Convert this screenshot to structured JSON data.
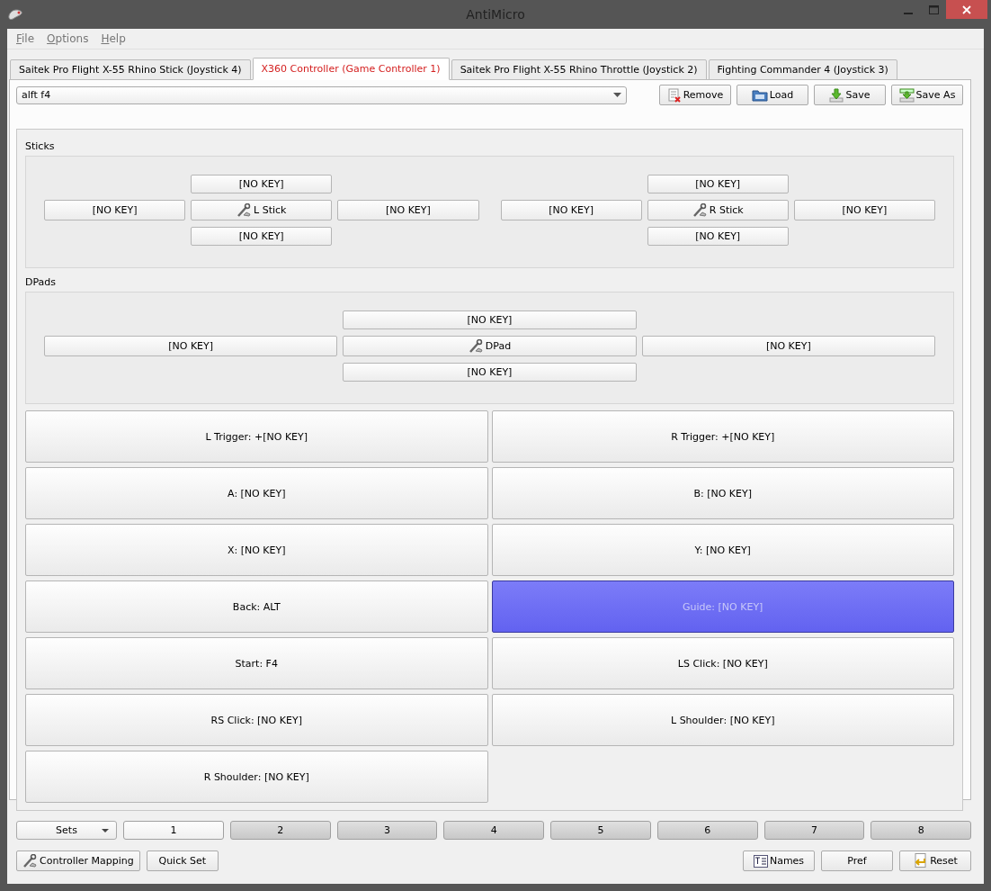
{
  "window": {
    "title": "AntiMicro"
  },
  "menu": [
    "File",
    "Options",
    "Help"
  ],
  "tabs": [
    {
      "label": "Saitek Pro Flight X-55 Rhino Stick (Joystick 4)",
      "selected": false
    },
    {
      "label": "X360 Controller (Game Controller 1)",
      "selected": true
    },
    {
      "label": "Saitek Pro Flight X-55 Rhino Throttle (Joystick 2)",
      "selected": false
    },
    {
      "label": "Fighting Commander 4 (Joystick 3)",
      "selected": false
    }
  ],
  "profile": {
    "value": "alft f4"
  },
  "profile_buttons": [
    {
      "kind": "remove",
      "label": "Remove"
    },
    {
      "kind": "load",
      "label": "Load"
    },
    {
      "kind": "save",
      "label": "Save"
    },
    {
      "kind": "saveas",
      "label": "Save As"
    }
  ],
  "sticks": {
    "title": "Sticks",
    "items": [
      {
        "up": "[NO KEY]",
        "left": "[NO KEY]",
        "center": "L Stick",
        "right": "[NO KEY]",
        "down": "[NO KEY]"
      },
      {
        "up": "[NO KEY]",
        "left": "[NO KEY]",
        "center": "R Stick",
        "right": "[NO KEY]",
        "down": "[NO KEY]"
      }
    ]
  },
  "dpads": {
    "title": "DPads",
    "items": [
      {
        "up": "[NO KEY]",
        "left": "[NO KEY]",
        "center": "DPad",
        "right": "[NO KEY]",
        "down": "[NO KEY]"
      }
    ]
  },
  "buttons": [
    {
      "label": "L Trigger: +[NO KEY]",
      "selected": false
    },
    {
      "label": "R Trigger: +[NO KEY]",
      "selected": false
    },
    {
      "label": "A: [NO KEY]",
      "selected": false
    },
    {
      "label": "B: [NO KEY]",
      "selected": false
    },
    {
      "label": "X: [NO KEY]",
      "selected": false
    },
    {
      "label": "Y: [NO KEY]",
      "selected": false
    },
    {
      "label": "Back: ALT",
      "selected": false
    },
    {
      "label": "Guide: [NO KEY]",
      "selected": true
    },
    {
      "label": "Start: F4",
      "selected": false
    },
    {
      "label": "LS Click: [NO KEY]",
      "selected": false
    },
    {
      "label": "RS Click: [NO KEY]",
      "selected": false
    },
    {
      "label": "L Shoulder: [NO KEY]",
      "selected": false
    },
    {
      "label": "R Shoulder: [NO KEY]",
      "selected": false
    }
  ],
  "sets_menu": {
    "label": "Sets"
  },
  "sets": [
    {
      "label": "1",
      "selected": true
    },
    {
      "label": "2",
      "selected": false
    },
    {
      "label": "3",
      "selected": false
    },
    {
      "label": "4",
      "selected": false
    },
    {
      "label": "5",
      "selected": false
    },
    {
      "label": "6",
      "selected": false
    },
    {
      "label": "7",
      "selected": false
    },
    {
      "label": "8",
      "selected": false
    }
  ],
  "bottom_left": [
    {
      "kind": "mapping",
      "label": "Controller Mapping"
    },
    {
      "kind": "plain",
      "label": "Quick Set"
    }
  ],
  "bottom_right": [
    {
      "kind": "names",
      "label": "Names"
    },
    {
      "kind": "plain",
      "label": "Pref"
    },
    {
      "kind": "reset",
      "label": "Reset"
    }
  ]
}
